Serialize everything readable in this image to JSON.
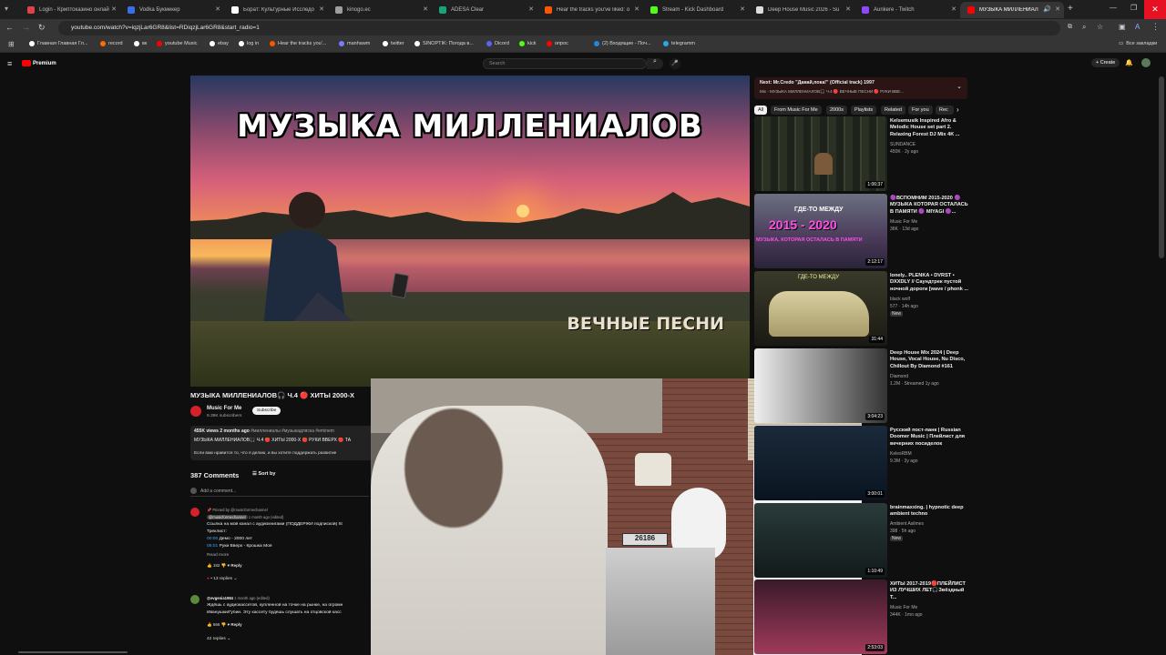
{
  "tabs": [
    {
      "label": "Login - Криптоказино онлай",
      "color": "#e0414a"
    },
    {
      "label": "Vodka Букмекер",
      "color": "#3a6ee8"
    },
    {
      "label": "Борат: Культурные Исследо",
      "color": "#ffffff"
    },
    {
      "label": "kinogo.ec",
      "color": "#9e9e9e"
    },
    {
      "label": "ADESA Clear",
      "color": "#1aa37a"
    },
    {
      "label": "Hear the tracks you've liked: o",
      "color": "#ff5500"
    },
    {
      "label": "Stream - Kick Dashboard",
      "color": "#53fc18"
    },
    {
      "label": "Deep House Music 2026 - Su",
      "color": "#dcdcdc"
    },
    {
      "label": "Aunkere - Twitch",
      "color": "#9146ff"
    },
    {
      "label": "МУЗЫКА МИЛЛЕНИАЛ",
      "color": "#ff0000"
    }
  ],
  "address": {
    "url": "youtube.com/watch?v=iqzjLar6GR8&list=RDiqzjLar6GR8&start_radio=1"
  },
  "bookmarks": {
    "items": [
      {
        "label": "Главная Главная Гл...",
        "color": "#ffffff"
      },
      {
        "label": "record",
        "color": "#ff6d00"
      },
      {
        "label": "вк",
        "color": "#ffffff"
      },
      {
        "label": "youtube Music",
        "color": "#ff0000"
      },
      {
        "label": "ebay",
        "color": "#ffffff"
      },
      {
        "label": "log in",
        "color": "#ffffff"
      },
      {
        "label": "Hear the tracks you'...",
        "color": "#ff5500"
      },
      {
        "label": "manhawm",
        "color": "#7b7bff"
      },
      {
        "label": "twitter",
        "color": "#ffffff"
      },
      {
        "label": "SINOPTIK: Погода в...",
        "color": "#ffffff"
      },
      {
        "label": "Dicord",
        "color": "#5865f2"
      },
      {
        "label": "kick",
        "color": "#53fc18"
      },
      {
        "label": "опрос",
        "color": "#ff0000"
      },
      {
        "label": "(2) Входящие - Поч...",
        "color": "#1e88e5"
      },
      {
        "label": "telegramm",
        "color": "#29a9eb"
      }
    ],
    "all": "Все закладки"
  },
  "yt": {
    "logo": "Premium",
    "search_placeholder": "Search",
    "create": "Create"
  },
  "video": {
    "art_title": "МУЗЫКА МИЛЛЕНИАЛОВ",
    "art_sub": "ВЕЧНЫЕ ПЕСНИ",
    "title": "МУЗЫКА МИЛЛЕНИАЛОВ🎧 Ч.4 🔴 ХИТЫ 2000-Х",
    "channel": "Music For Me",
    "subscribers": "9.39K subscribers",
    "subscribe": "Subscribe",
    "stats": "455K views  2 months ago",
    "tags": "#миллениалы #музыкадляска #eminem",
    "desc_line1": "МУЗЫКА МИЛЛЕНИАЛОВ🎧 Ч.4 🔴 ХИТЫ 2000-Х 🔴 РУКИ ВВЕРХ 🔴 ТА",
    "desc_line2": "Если вам нравится то, что я делаю, и вы хотите поддержать развитие"
  },
  "comments": {
    "count": "387 Comments",
    "sort": "Sort by",
    "add": "Add a comment...",
    "pinned": "Pinned by @musicformechannel",
    "c1_author": "@musicformechannel",
    "c1_time": "1 month ago (edited)",
    "c1_text": "Ссылка на мой канал с аудиокнигами (ПОДДЕРЖИ подпиской) ht",
    "c1_tracklist": "Треклист:",
    "c1_t1_time": "00:00",
    "c1_t1": "Демо - 2000 лет",
    "c1_t2_time": "05:01",
    "c1_t2": "Руки Вверх - Крошка Моя",
    "readmore": "Read more",
    "c1_likes": "182",
    "reply": "Reply",
    "c1_replies": "• 13 replies",
    "c2_author": "@evgenia1984",
    "c2_time": "1 month ago (edited)",
    "c2_text1": "Ждёшь с аудиокассетой, купленной на точке на рынке, на огромн",
    "c2_text2": "Иванушки/Губин. Эту кассету будешь слушать на отцовской касс",
    "c2_likes": "666",
    "c2_replies": "42 replies"
  },
  "next": {
    "label": "Next: Mr.Credo \"Давай,пока!\" (Official track) 1997",
    "sub": "Mix - МУЗЫКА МИЛЛЕНИАЛОВ🎧 Ч.4 🔴 ВЕЧНЫЕ ПЕСНИ 🔴 РУКИ ВВЕ..."
  },
  "chips": [
    "All",
    "From Music For Me",
    "2000s",
    "Playlists",
    "Related",
    "For you",
    "Rec"
  ],
  "recs": [
    {
      "title": "Kelsemusik Inspired Afro & Melodic House set part 2. Relaxing Forest DJ Mix 4K ...",
      "channel": "SUNDANCE",
      "meta": "450K · 2y ago",
      "duration": "1:06:37"
    },
    {
      "title": "🟣ВСПОМНИМ 2015-2020 🟣 МУЗЫКА КОТОРАЯ ОСТАЛАСЬ В ПАМЯТИ 🟣 MIYAGI 🟣...",
      "channel": "Music For Me",
      "meta": "36K · 13d ago",
      "duration": "2:12:17",
      "thumb_text1": "ГДЕ-ТО МЕЖДУ",
      "thumb_text2": "2015 - 2020",
      "thumb_text3": "МУЗЫКА, КОТОРАЯ ОСТАЛАСЬ В ПАМЯТИ"
    },
    {
      "title": "lonely.. PLENKA • DVRST • DXXDLY // Саундтрек пустой ночной дороги [wave / phonk ...",
      "channel": "black wolf",
      "meta": "577 · 14h ago",
      "badge": "New",
      "duration": "31:44",
      "thumb_text1": "ГДЕ-ТО МЕЖДУ"
    },
    {
      "title": "Deep House Mix 2024 | Deep House, Vocal House, Nu Disco, Chillout By Diamond #161",
      "channel": "Diamond",
      "meta": "1.2M · Streamed 1y ago",
      "duration": "3:04:23"
    },
    {
      "title": "Русский пост-панк | Russian Doomer Music | Плейлист для вечерних посиделок",
      "channel": "KelesRBM",
      "meta": "9.3M · 3y ago",
      "duration": "3:00:01"
    },
    {
      "title": "brainmaxxing. | hypnotic deep ambient techno",
      "channel": "Ambient Asilmes",
      "meta": "398 · 5h ago",
      "badge": "New",
      "duration": "1:10:49"
    },
    {
      "title": "ХИТЫ 2017-2019🔴ПЛЕЙЛИСТ ИЗ ЛУЧШИХ ЛЕТ🎧Звёздный Т...",
      "channel": "Music For Me",
      "meta": "344K · 1mo ago",
      "duration": "2:53:03"
    }
  ],
  "cam": {
    "plate": "26186"
  }
}
